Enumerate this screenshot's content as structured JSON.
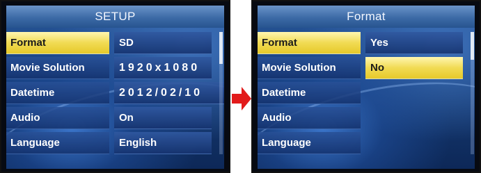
{
  "left_screen": {
    "title": "SETUP",
    "menu": [
      {
        "label": "Format",
        "value": "SD",
        "selected": true
      },
      {
        "label": "Movie Solution",
        "value": "1920x1080",
        "selected": false
      },
      {
        "label": "Datetime",
        "value": "2012/02/10",
        "selected": false
      },
      {
        "label": "Audio",
        "value": "On",
        "selected": false
      },
      {
        "label": "Language",
        "value": "English",
        "selected": false
      }
    ]
  },
  "right_screen": {
    "title": "Format",
    "menu": [
      {
        "label": "Format"
      },
      {
        "label": "Movie Solution"
      },
      {
        "label": "Datetime"
      },
      {
        "label": "Audio"
      },
      {
        "label": "Language"
      }
    ],
    "options": [
      {
        "label": "Yes",
        "selected": false
      },
      {
        "label": "No",
        "selected": true
      }
    ]
  },
  "colors": {
    "highlight": "#f1db54",
    "arrow": "#e21b1b",
    "panel": "#173e78"
  },
  "icons": {
    "arrow": "right-arrow-icon"
  }
}
